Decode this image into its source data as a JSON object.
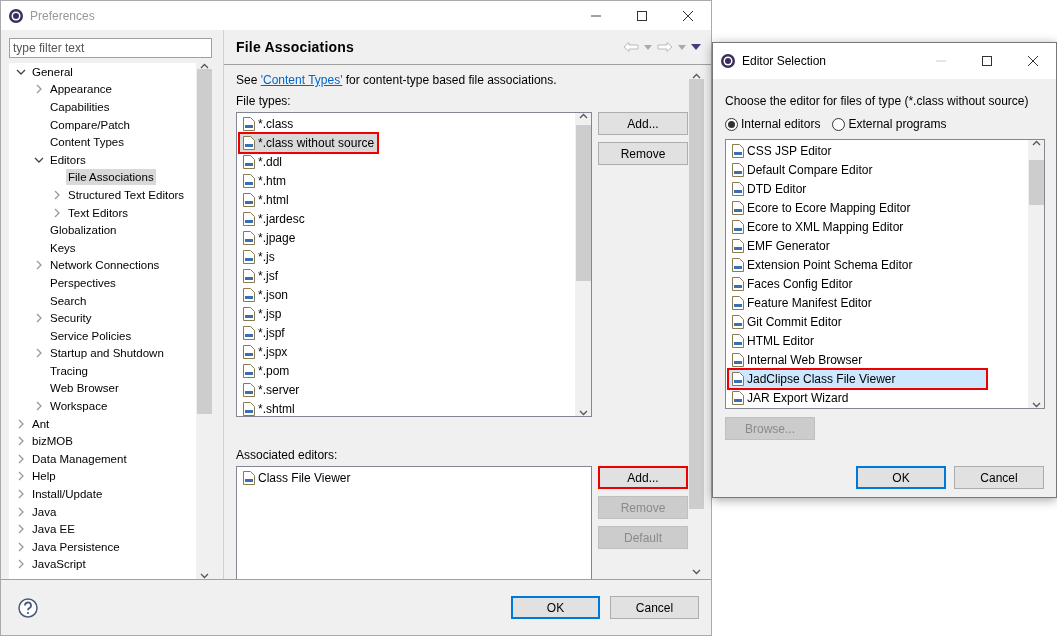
{
  "preferences": {
    "title": "Preferences",
    "filter": {
      "placeholder": "type filter text"
    },
    "tree": [
      {
        "label": "General",
        "kind": "folder",
        "expanded": true,
        "selected": false,
        "children": [
          {
            "label": "Appearance",
            "kind": "folder",
            "expanded": false,
            "selected": false
          },
          {
            "label": "Capabilities",
            "kind": "leaf",
            "selected": false
          },
          {
            "label": "Compare/Patch",
            "kind": "leaf",
            "selected": false
          },
          {
            "label": "Content Types",
            "kind": "leaf",
            "selected": false
          },
          {
            "label": "Editors",
            "kind": "folder",
            "expanded": true,
            "selected": false,
            "children": [
              {
                "label": "File Associations",
                "kind": "leaf",
                "selected": true
              },
              {
                "label": "Structured Text Editors",
                "kind": "folder",
                "expanded": false,
                "selected": false
              },
              {
                "label": "Text Editors",
                "kind": "folder",
                "expanded": false,
                "selected": false
              }
            ]
          },
          {
            "label": "Globalization",
            "kind": "leaf",
            "selected": false
          },
          {
            "label": "Keys",
            "kind": "leaf",
            "selected": false
          },
          {
            "label": "Network Connections",
            "kind": "folder",
            "expanded": false,
            "selected": false
          },
          {
            "label": "Perspectives",
            "kind": "leaf",
            "selected": false
          },
          {
            "label": "Search",
            "kind": "leaf",
            "selected": false
          },
          {
            "label": "Security",
            "kind": "folder",
            "expanded": false,
            "selected": false
          },
          {
            "label": "Service Policies",
            "kind": "leaf",
            "selected": false
          },
          {
            "label": "Startup and Shutdown",
            "kind": "folder",
            "expanded": false,
            "selected": false
          },
          {
            "label": "Tracing",
            "kind": "leaf",
            "selected": false
          },
          {
            "label": "Web Browser",
            "kind": "leaf",
            "selected": false
          },
          {
            "label": "Workspace",
            "kind": "folder",
            "expanded": false,
            "selected": false
          }
        ]
      },
      {
        "label": "Ant",
        "kind": "folder",
        "expanded": false,
        "selected": false
      },
      {
        "label": "bizMOB",
        "kind": "folder",
        "expanded": false,
        "selected": false
      },
      {
        "label": "Data Management",
        "kind": "folder",
        "expanded": false,
        "selected": false
      },
      {
        "label": "Help",
        "kind": "folder",
        "expanded": false,
        "selected": false
      },
      {
        "label": "Install/Update",
        "kind": "folder",
        "expanded": false,
        "selected": false
      },
      {
        "label": "Java",
        "kind": "folder",
        "expanded": false,
        "selected": false
      },
      {
        "label": "Java EE",
        "kind": "folder",
        "expanded": false,
        "selected": false
      },
      {
        "label": "Java Persistence",
        "kind": "folder",
        "expanded": false,
        "selected": false
      },
      {
        "label": "JavaScript",
        "kind": "folder",
        "expanded": false,
        "selected": false
      }
    ],
    "page": {
      "title": "File Associations",
      "intro": {
        "before": "See ",
        "link": "'Content Types'",
        "after": " for content-type based file associations."
      },
      "file_types_label": "File types:",
      "file_types": [
        {
          "label": "*.class",
          "selected": false,
          "highlighted": false
        },
        {
          "label": "*.class without source",
          "selected": true,
          "highlighted": true
        },
        {
          "label": "*.ddl",
          "selected": false,
          "highlighted": false
        },
        {
          "label": "*.htm",
          "selected": false,
          "highlighted": false
        },
        {
          "label": "*.html",
          "selected": false,
          "highlighted": false
        },
        {
          "label": "*.jardesc",
          "selected": false,
          "highlighted": false
        },
        {
          "label": "*.jpage",
          "selected": false,
          "highlighted": false
        },
        {
          "label": "*.js",
          "selected": false,
          "highlighted": false
        },
        {
          "label": "*.jsf",
          "selected": false,
          "highlighted": false
        },
        {
          "label": "*.json",
          "selected": false,
          "highlighted": false
        },
        {
          "label": "*.jsp",
          "selected": false,
          "highlighted": false
        },
        {
          "label": "*.jspf",
          "selected": false,
          "highlighted": false
        },
        {
          "label": "*.jspx",
          "selected": false,
          "highlighted": false
        },
        {
          "label": "*.pom",
          "selected": false,
          "highlighted": false
        },
        {
          "label": "*.server",
          "selected": false,
          "highlighted": false
        },
        {
          "label": "*.shtml",
          "selected": false,
          "highlighted": false
        }
      ],
      "file_type_buttons": [
        {
          "label": "Add...",
          "disabled": false,
          "highlighted": false
        },
        {
          "label": "Remove",
          "disabled": false,
          "highlighted": false
        }
      ],
      "editors_label": "Associated editors:",
      "editors": [
        {
          "label": "Class File Viewer",
          "selected": false
        }
      ],
      "editor_buttons": [
        {
          "label": "Add...",
          "disabled": false,
          "highlighted": true
        },
        {
          "label": "Remove",
          "disabled": true,
          "highlighted": false
        },
        {
          "label": "Default",
          "disabled": true,
          "highlighted": false
        }
      ]
    },
    "buttons": [
      {
        "label": "OK",
        "default": true
      },
      {
        "label": "Cancel",
        "default": false
      }
    ]
  },
  "editor_selection": {
    "title": "Editor Selection",
    "prompt": "Choose the editor for files of type (*.class without source)",
    "options": [
      {
        "label": "Internal editors",
        "selected": true
      },
      {
        "label": "External programs",
        "selected": false
      }
    ],
    "editors": [
      {
        "label": "CSS JSP Editor",
        "selected": false,
        "highlighted": false
      },
      {
        "label": "Default Compare Editor",
        "selected": false,
        "highlighted": false
      },
      {
        "label": "DTD Editor",
        "selected": false,
        "highlighted": false
      },
      {
        "label": "Ecore to Ecore Mapping Editor",
        "selected": false,
        "highlighted": false
      },
      {
        "label": "Ecore to XML Mapping Editor",
        "selected": false,
        "highlighted": false
      },
      {
        "label": "EMF Generator",
        "selected": false,
        "highlighted": false
      },
      {
        "label": "Extension Point Schema Editor",
        "selected": false,
        "highlighted": false
      },
      {
        "label": "Faces Config Editor",
        "selected": false,
        "highlighted": false
      },
      {
        "label": "Feature Manifest Editor",
        "selected": false,
        "highlighted": false
      },
      {
        "label": "Git Commit Editor",
        "selected": false,
        "highlighted": false
      },
      {
        "label": "HTML Editor",
        "selected": false,
        "highlighted": false
      },
      {
        "label": "Internal Web Browser",
        "selected": false,
        "highlighted": false
      },
      {
        "label": "JadClipse Class File Viewer",
        "selected": true,
        "highlighted": true
      },
      {
        "label": "JAR Export Wizard",
        "selected": false,
        "highlighted": false
      }
    ],
    "browse": {
      "label": "Browse...",
      "disabled": true
    },
    "buttons": [
      {
        "label": "OK",
        "default": true
      },
      {
        "label": "Cancel",
        "default": false
      }
    ]
  }
}
